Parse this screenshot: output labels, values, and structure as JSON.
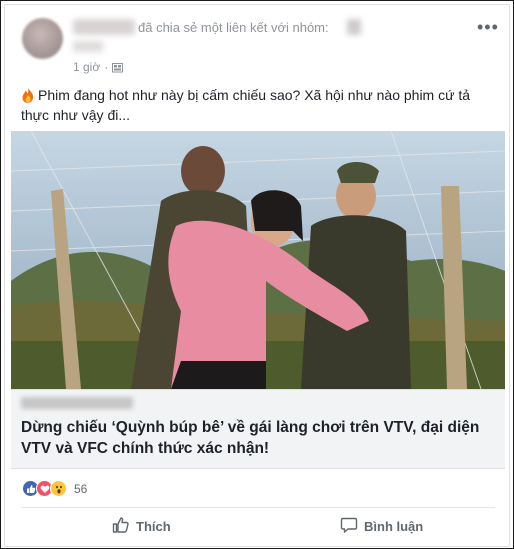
{
  "post": {
    "shared_text": "đã chia sẻ một liên kết với nhóm:",
    "more_label": "•••",
    "time": "1 giờ",
    "time_separator": "·",
    "message_line1": "Phim đang hot như này bị cấm chiếu sao? Xã hội như nào phim cứ tả",
    "message_line2": "thực như vậy đi..."
  },
  "link": {
    "headline_before": "Dừng chiếu ",
    "headline_quote": "‘Quỳnh búp bê’",
    "headline_after": " về gái làng chơi trên VTV, đại diện VTV và VFC chính thức xác nhận!"
  },
  "reactions": {
    "count": "56",
    "types": [
      "like-icon",
      "love-icon",
      "wow-icon"
    ],
    "colors": {
      "like": "#4267b2",
      "love": "#f25268",
      "wow": "#fcc73f"
    }
  },
  "actions": {
    "like_label": "Thích",
    "comment_label": "Bình luận"
  }
}
